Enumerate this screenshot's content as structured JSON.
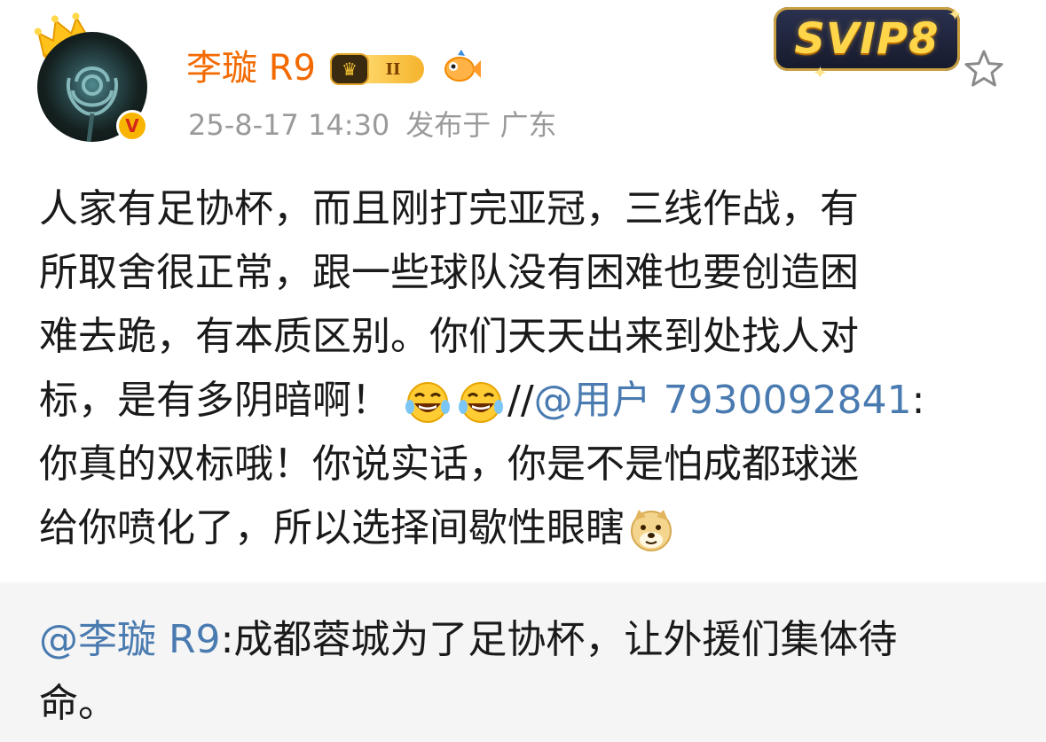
{
  "author": {
    "name": "李璇 R9",
    "level_badge": "II",
    "timestamp": "25-8-17 14:30",
    "location_label": "发布于 广东"
  },
  "membership": {
    "svip_label": "SVIP8"
  },
  "post": {
    "line1": "人家有足协杯，而且刚打完亚冠，三线作战，有",
    "line2": "所取舍很正常，跟一些球队没有困难也要创造困",
    "line3": "难去跪，有本质区别。你们天天出来到处找人对",
    "line4_text": "标，是有多阴暗啊！",
    "line4_sep": "//",
    "line4_mention": "@用户 7930092841",
    "line4_colon": ":",
    "line5": "你真的双标哦！你说实话，你是不是怕成都球迷",
    "line6": "给你喷化了，所以选择间歇性眼瞎"
  },
  "repost": {
    "mention": "@李璇 R9",
    "line1_text": ":成都蓉城为了足协杯，让外援们集体待",
    "line2": "命。"
  },
  "icons": {
    "crown": "crown-icon",
    "verified": "verified-v-icon",
    "fish": "fish-badge-icon",
    "star": "favorite-star-icon",
    "laugh": "tears-of-joy-emoji",
    "doge": "doge-emoji"
  },
  "colors": {
    "username": "#f36a00",
    "link": "#4a7bb0",
    "meta": "#9a9a9a",
    "repost_bg": "#f5f5f5"
  }
}
